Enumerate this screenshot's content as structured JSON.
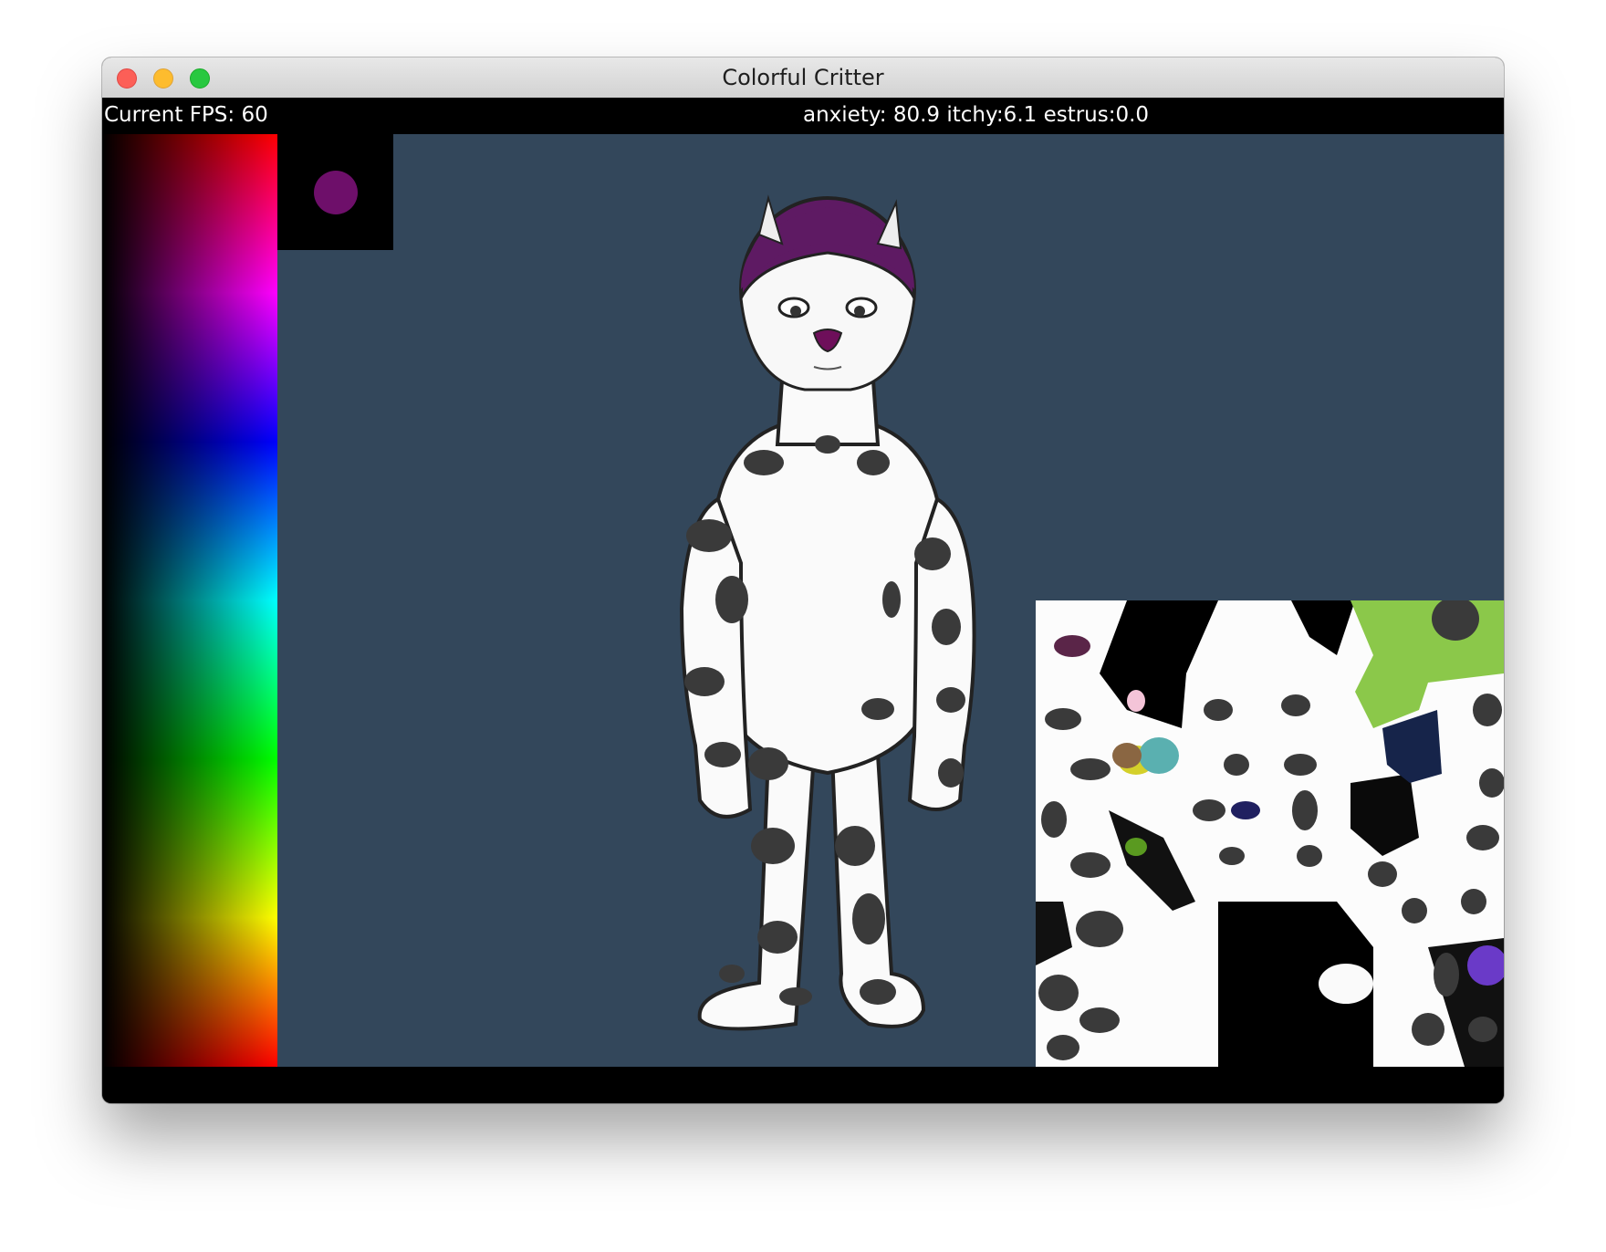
{
  "window": {
    "title": "Colorful Critter"
  },
  "status": {
    "fps_text": "Current FPS: 60",
    "stats_text": "anxiety: 80.9 itchy:6.1 estrus:0.0"
  },
  "palette": {
    "selected_color": "#6e0f6a",
    "background_color": "#33475b"
  }
}
